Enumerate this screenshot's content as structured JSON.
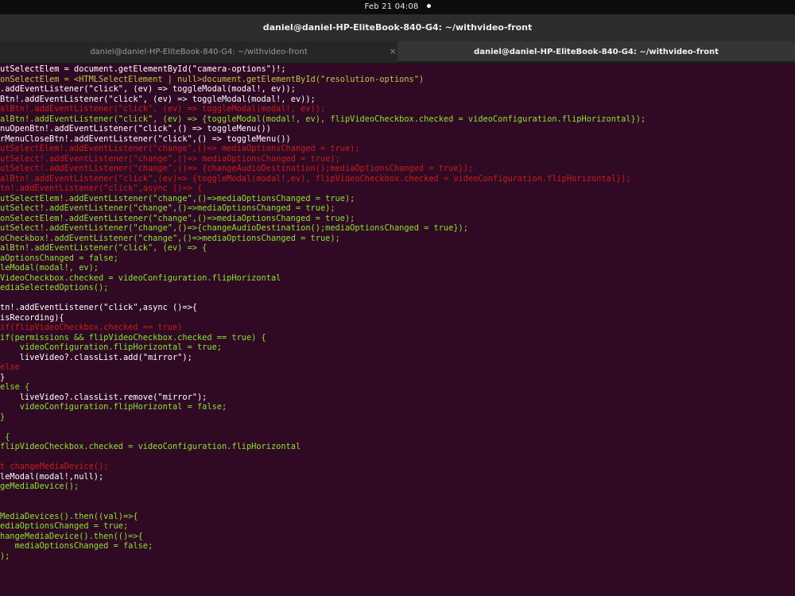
{
  "topbar": {
    "datetime": "Feb 21  04:08"
  },
  "window": {
    "title": "daniel@daniel-HP-EliteBook-840-G4: ~/withvideo-front"
  },
  "tabs": [
    {
      "label": "daniel@daniel-HP-EliteBook-840-G4: ~/withvideo-front",
      "active": false
    },
    {
      "label": "daniel@daniel-HP-EliteBook-840-G4: ~/withvideo-front",
      "active": true
    }
  ],
  "tab_close_glyph": "×",
  "colors": {
    "terminal_bg": "#300a24",
    "white": "#ffffff",
    "green": "#8ae234",
    "yellow": "#b8c94a",
    "red": "#cc1b1b"
  },
  "terminal_lines": [
    {
      "text": "utSelectElem = document.getElementById(\"camera-options\")!;",
      "color": "white"
    },
    {
      "text": "onSelectElem = <HTMLSelectElement | null>document.getElementById(\"resolution-options\")",
      "color": "yellow"
    },
    {
      "text": ".addEventListener(\"click\", (ev) => toggleModal(modal!, ev));",
      "color": "white"
    },
    {
      "text": "Btn!.addEventListener(\"click\", (ev) => toggleModal(modal!, ev));",
      "color": "white"
    },
    {
      "text": "alBtn!.addEventListener(\"click\", (ev) => toggleModal(modal!, ev));",
      "color": "red"
    },
    {
      "text": "alBtn!.addEventListener(\"click\", (ev) => {toggleModal(modal!, ev), flipVideoCheckbox.checked = videoConfiguration.flipHorizontal});",
      "color": "green"
    },
    {
      "text": "nuOpenBtn!.addEventListener(\"click\",() => toggleMenu())",
      "color": "white"
    },
    {
      "text": "rMenuCloseBtn!.addEventListener(\"click\",() => toggleMenu())",
      "color": "white"
    },
    {
      "text": "utSelectElem!.addEventListener(\"change\",()=> mediaOptionsChanged = true);",
      "color": "red"
    },
    {
      "text": "utSelect!.addEventListener(\"change\",()=> mediaOptionsChanged = true);",
      "color": "red"
    },
    {
      "text": "utSelect!.addEventListener(\"change\",()=> {changeAudioDestination();mediaOptionsChanged = true});",
      "color": "red"
    },
    {
      "text": "alBtn!.addEventListener(\"click\",(ev)=> {toggleModal(modal!,ev), flipVideoCheckbox.checked = videoConfiguration.flipHorizontal});",
      "color": "red"
    },
    {
      "text": "tn!.addEventListener(\"click\",async ()=> {",
      "color": "red"
    },
    {
      "text": "utSelectElem!.addEventListener(\"change\",()=>mediaOptionsChanged = true);",
      "color": "green"
    },
    {
      "text": "utSelect!.addEventListener(\"change\",()=>mediaOptionsChanged = true);",
      "color": "green"
    },
    {
      "text": "onSelectElem!.addEventListener(\"change\",()=>mediaOptionsChanged = true);",
      "color": "green"
    },
    {
      "text": "utSelect!.addEventListener(\"change\",()=>{changeAudioDestination();mediaOptionsChanged = true});",
      "color": "green"
    },
    {
      "text": "oCheckbox!.addEventListener(\"change\",()=>mediaOptionsChanged = true);",
      "color": "green"
    },
    {
      "text": "alBtn!.addEventListener(\"click\", (ev) => {",
      "color": "green"
    },
    {
      "text": "aOptionsChanged = false;",
      "color": "green"
    },
    {
      "text": "leModal(modal!, ev);",
      "color": "green"
    },
    {
      "text": "VideoCheckbox.checked = videoConfiguration.flipHorizontal",
      "color": "green"
    },
    {
      "text": "ediaSelectedOptions();",
      "color": "green"
    },
    {
      "text": "",
      "color": "white"
    },
    {
      "text": "tn!.addEventListener(\"click\",async ()=>{",
      "color": "white"
    },
    {
      "text": "isRecording){",
      "color": "white"
    },
    {
      "text": "if(flipVideoCheckbox.checked == true)",
      "color": "red"
    },
    {
      "text": "if(permissions && flipVideoCheckbox.checked == true) {",
      "color": "green"
    },
    {
      "text": "    videoConfiguration.flipHorizontal = true;",
      "color": "green"
    },
    {
      "text": "    liveVideo?.classList.add(\"mirror\");",
      "color": "white"
    },
    {
      "text": "else",
      "color": "red"
    },
    {
      "text": "}",
      "color": "white"
    },
    {
      "text": "else {",
      "color": "green"
    },
    {
      "text": "    liveVideo?.classList.remove(\"mirror\");",
      "color": "white"
    },
    {
      "text": "    videoConfiguration.flipHorizontal = false;",
      "color": "green"
    },
    {
      "text": "}",
      "color": "green"
    },
    {
      "text": "",
      "color": "white"
    },
    {
      "text": " {",
      "color": "green"
    },
    {
      "text": "flipVideoCheckbox.checked = videoConfiguration.flipHorizontal",
      "color": "green"
    },
    {
      "text": "",
      "color": "white"
    },
    {
      "text": "t changeMediaDevice();",
      "color": "red"
    },
    {
      "text": "leModal(modal!,null);",
      "color": "white"
    },
    {
      "text": "geMediaDevice();",
      "color": "green"
    },
    {
      "text": "",
      "color": "white"
    },
    {
      "text": "",
      "color": "white"
    },
    {
      "text": "MediaDevices().then((val)=>{",
      "color": "green"
    },
    {
      "text": "ediaOptionsChanged = true;",
      "color": "green"
    },
    {
      "text": "hangeMediaDevice().then(()=>{",
      "color": "green"
    },
    {
      "text": "   mediaOptionsChanged = false;",
      "color": "green"
    },
    {
      "text": ");",
      "color": "green"
    }
  ]
}
